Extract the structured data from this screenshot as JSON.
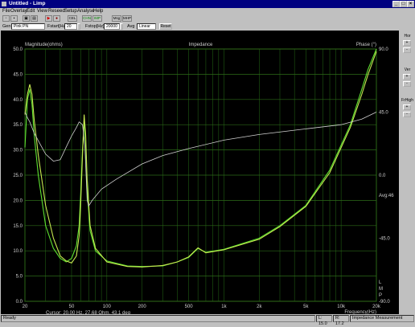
{
  "window": {
    "title": "Untitled - Limp"
  },
  "title_buttons": [
    "_",
    "□",
    "×"
  ],
  "menu": [
    "File",
    "Overlay",
    "Edit",
    "View",
    "Reseed",
    "Setup",
    "Analyse",
    "Help"
  ],
  "toolbar": {
    "buttons": [
      "new-icon",
      "open-icon",
      "save-icon",
      "print-icon",
      "play-icon",
      "stop-icon"
    ],
    "labels": [
      "CEL",
      "CHN",
      "IMP",
      "Msg",
      "MHP"
    ]
  },
  "gen": {
    "label": "Gen",
    "value": "Pink PN",
    "fstart_label": "Fstart[Hz]",
    "fstart_value": "20",
    "fstop_label": "Fstop[Hz]",
    "fstop_value": "20000",
    "avg_label": "Avg",
    "avg_value": "Linear",
    "reset_label": "Reset"
  },
  "right_panel": {
    "hor_label": "Hor",
    "hor_plus": "+",
    "hor_minus": "-",
    "ver_label": "Ver",
    "ver_plus": "+",
    "ver_minus": "-",
    "freq_label": "FrHigh",
    "freq_plus": "+",
    "freq_minus": "-"
  },
  "status": {
    "ready": "Ready",
    "l_value": "L: 15.0",
    "r_value": "R: 17.2",
    "mode": "Impedance Measurement"
  },
  "chart_data": {
    "type": "line",
    "title": "Impedance",
    "ylabel_left": "Magnitude(ohms)",
    "ylabel_right": "Phase (°)",
    "xlabel": "Frequency(Hz)",
    "xscale": "log",
    "xlim": [
      20,
      20000
    ],
    "ylim": [
      0,
      50
    ],
    "y2lim": [
      -90,
      90
    ],
    "x_ticks": [
      {
        "v": 20,
        "l": "20"
      },
      {
        "v": 50,
        "l": "50"
      },
      {
        "v": 100,
        "l": "100"
      },
      {
        "v": 200,
        "l": "200"
      },
      {
        "v": 500,
        "l": "500"
      },
      {
        "v": 1000,
        "l": "1k"
      },
      {
        "v": 2000,
        "l": "2k"
      },
      {
        "v": 5000,
        "l": "5k"
      },
      {
        "v": 10000,
        "l": "10k"
      },
      {
        "v": 20000,
        "l": "20k"
      }
    ],
    "y_ticks": [
      "0.0",
      "5.0",
      "10.0",
      "15.0",
      "20.0",
      "25.0",
      "30.0",
      "35.0",
      "40.0",
      "45.0",
      "50.0"
    ],
    "y2_ticks": [
      "90.0",
      "45.0",
      "0.0",
      "-45.0",
      "-90.0"
    ],
    "avg_label": "Avg:46",
    "lmp_labels": [
      "L",
      "M",
      "P"
    ],
    "cursor_text": "Cursor: 20.00 Hz, 27.68 Ohm, 43.1 deg",
    "grid": true,
    "series": [
      {
        "color": "#5ee030",
        "values": [
          [
            20,
            30.5
          ],
          [
            21,
            40
          ],
          [
            22,
            42
          ],
          [
            23,
            39
          ],
          [
            24,
            33
          ],
          [
            26,
            25
          ],
          [
            30,
            15
          ],
          [
            35,
            10.5
          ],
          [
            40,
            8.5
          ],
          [
            45,
            7.8
          ],
          [
            50,
            8.5
          ],
          [
            55,
            11
          ],
          [
            58,
            15
          ],
          [
            60,
            22
          ],
          [
            62,
            30
          ],
          [
            64,
            36
          ],
          [
            66,
            31
          ],
          [
            68,
            22
          ],
          [
            72,
            14
          ],
          [
            80,
            10
          ],
          [
            100,
            8
          ],
          [
            150,
            7
          ],
          [
            200,
            6.9
          ],
          [
            300,
            7
          ],
          [
            400,
            7.8
          ],
          [
            500,
            8.7
          ],
          [
            600,
            10.5
          ],
          [
            700,
            9.7
          ],
          [
            1000,
            10.3
          ],
          [
            2000,
            12.5
          ],
          [
            3000,
            15
          ],
          [
            5000,
            19
          ],
          [
            8000,
            26
          ],
          [
            12000,
            35
          ],
          [
            15000,
            42
          ],
          [
            17000,
            46
          ],
          [
            20000,
            50
          ]
        ]
      },
      {
        "color": "#c6e850",
        "values": [
          [
            20,
            37
          ],
          [
            21,
            41
          ],
          [
            22,
            43
          ],
          [
            23,
            41
          ],
          [
            24,
            36
          ],
          [
            26,
            29
          ],
          [
            30,
            19
          ],
          [
            35,
            12.5
          ],
          [
            40,
            9
          ],
          [
            45,
            8
          ],
          [
            50,
            7.6
          ],
          [
            55,
            9
          ],
          [
            58,
            13
          ],
          [
            60,
            20
          ],
          [
            62,
            29
          ],
          [
            64,
            37
          ],
          [
            66,
            33
          ],
          [
            68,
            24
          ],
          [
            72,
            15
          ],
          [
            80,
            10.5
          ],
          [
            100,
            7.8
          ],
          [
            150,
            6.9
          ],
          [
            200,
            6.8
          ],
          [
            300,
            7.1
          ],
          [
            400,
            7.8
          ],
          [
            500,
            8.8
          ],
          [
            600,
            10.6
          ],
          [
            700,
            9.6
          ],
          [
            1000,
            10.2
          ],
          [
            2000,
            12.3
          ],
          [
            3000,
            14.8
          ],
          [
            5000,
            18.8
          ],
          [
            8000,
            25.5
          ],
          [
            12000,
            34.5
          ],
          [
            15000,
            41
          ],
          [
            17000,
            45
          ],
          [
            20000,
            49.5
          ]
        ]
      },
      {
        "color": "#d0d0d0",
        "axis": "phase",
        "values": [
          [
            20,
            45
          ],
          [
            21,
            41
          ],
          [
            22,
            38
          ],
          [
            24,
            30
          ],
          [
            27,
            22
          ],
          [
            30,
            15
          ],
          [
            35,
            10
          ],
          [
            40,
            11
          ],
          [
            45,
            20
          ],
          [
            50,
            28
          ],
          [
            55,
            34
          ],
          [
            58,
            38
          ],
          [
            62,
            36
          ],
          [
            65,
            20
          ],
          [
            68,
            -18
          ],
          [
            70,
            -22
          ],
          [
            75,
            -18
          ],
          [
            90,
            -10
          ],
          [
            120,
            -3
          ],
          [
            200,
            8
          ],
          [
            300,
            14
          ],
          [
            500,
            19
          ],
          [
            1000,
            25
          ],
          [
            2000,
            29
          ],
          [
            5000,
            33
          ],
          [
            10000,
            36
          ],
          [
            15000,
            40
          ],
          [
            20000,
            45
          ]
        ]
      }
    ]
  }
}
